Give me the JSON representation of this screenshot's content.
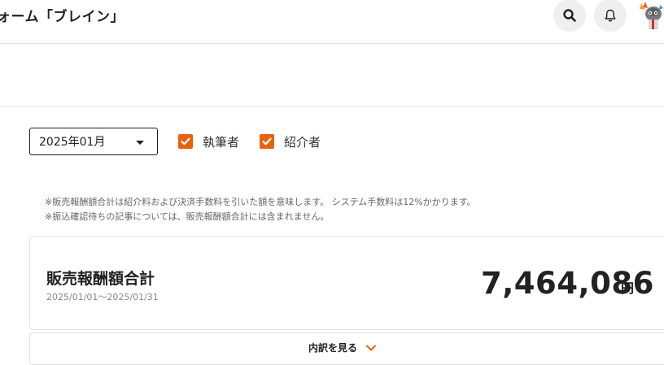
{
  "header": {
    "title": "ォーム「ブレイン」",
    "search_icon": "search-icon",
    "notification_icon": "bell-icon"
  },
  "filters": {
    "month_select_value": "2025年01月",
    "checkboxes": [
      {
        "label": "執筆者",
        "checked": true
      },
      {
        "label": "紹介者",
        "checked": true
      }
    ]
  },
  "notes": [
    "※販売報酬額合計は紹介料および決済手数料を引いた額を意味します。 システム手数料は12%かかります。",
    "※振込確認待ちの記事については、販売報酬額合計には含まれません。"
  ],
  "summary": {
    "title": "販売報酬額合計",
    "period": "2025/01/01〜2025/01/31",
    "amount": "7,464,086",
    "unit": "円"
  },
  "detail": {
    "label": "内訳を見る"
  },
  "colors": {
    "accent": "#e8620e",
    "border": "#e0e0e0",
    "icon_bg": "#efefef"
  }
}
